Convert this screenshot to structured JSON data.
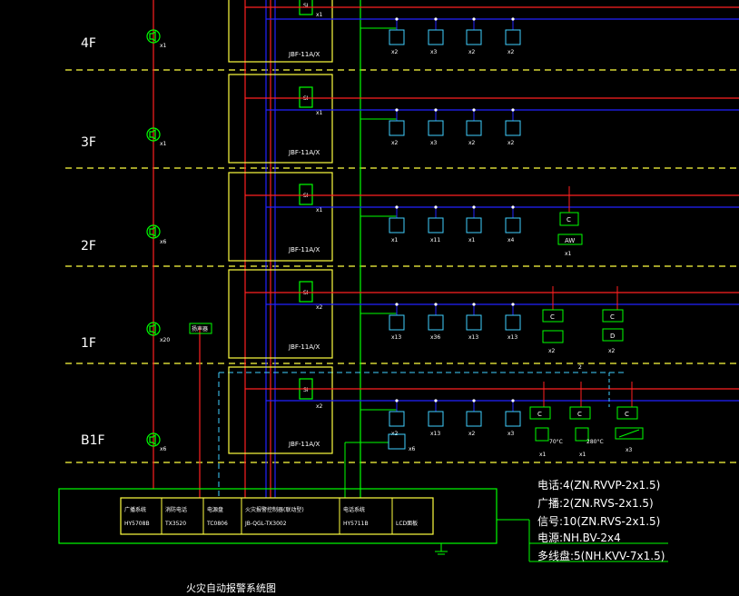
{
  "floors": [
    "4F",
    "3F",
    "2F",
    "1F",
    "B1F"
  ],
  "speaker_counts": [
    "x1",
    "x1",
    "x6",
    "x20",
    "x6"
  ],
  "panel_model": "JBF-11A/X",
  "module_symbol": "SI",
  "module_counts": [
    "x1",
    "x1",
    "x1",
    "x2",
    "x2"
  ],
  "device_rows": [
    [
      "x2",
      "x3",
      "x2",
      "x2"
    ],
    [
      "x2",
      "x3",
      "x2",
      "x2"
    ],
    [
      "x1",
      "x11",
      "x1",
      "x4"
    ],
    [
      "x13",
      "x36",
      "x13",
      "x13"
    ],
    [
      "x2",
      "x13",
      "x2",
      "x3"
    ]
  ],
  "floor2_extra": {
    "symbol": "C",
    "device": "AW",
    "count": "x1"
  },
  "floor1_extra": {
    "symbol_a": "C",
    "symbol_b": "D",
    "count_a": "x2",
    "count_b": "x2"
  },
  "b1_extra": {
    "c": "C",
    "temp_a": "70°C",
    "temp_b": "280°C",
    "count_a": "x1",
    "count_b": "x1",
    "count_c": "x3",
    "count_tel": "x6",
    "note": "2"
  },
  "amplifier_label": "扬声器",
  "host_cells": [
    {
      "title": "广播系统",
      "model": "HY5708B"
    },
    {
      "title": "消防电话",
      "model": "TX3520"
    },
    {
      "title": "电源盘",
      "model": "TC0806"
    },
    {
      "title": "火灾报警控制器(联动型)",
      "model": "JB-QGL-TX3002"
    },
    {
      "title": "电话系统",
      "model": "HY5711B"
    },
    {
      "title": "",
      "model": "LCD面板"
    }
  ],
  "legend": [
    "电话:4(ZN.RVVP-2x1.5)",
    "广播:2(ZN.RVS-2x1.5)",
    "信号:10(ZN.RVS-2x1.5)",
    "电源:NH.BV-2x4",
    "多线盘:5(NH.KVV-7x1.5)"
  ],
  "title": "火灾自动报警系统图",
  "colors": {
    "red": "#ff2020",
    "blue": "#2222ff",
    "green": "#00ff00",
    "yellow": "#ffff40",
    "cyan": "#40d0ff"
  }
}
